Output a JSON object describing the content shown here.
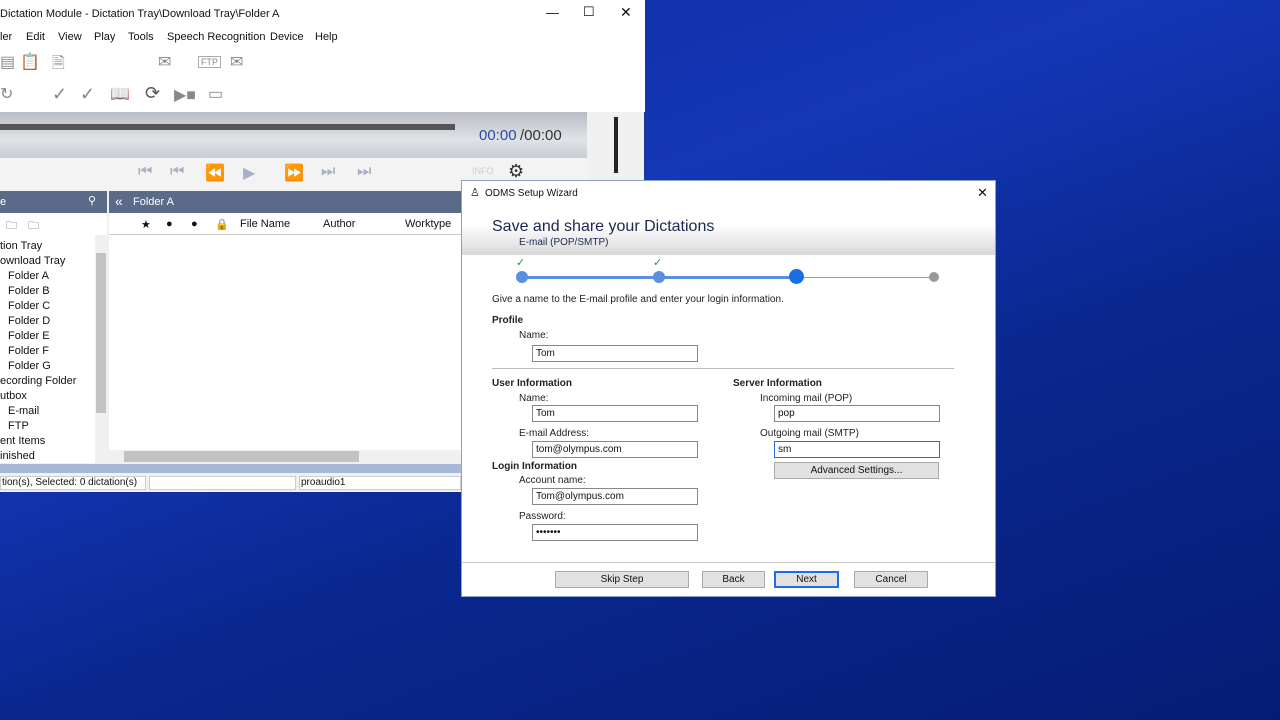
{
  "main": {
    "title": "Dictation Module - Dictation Tray\\Download Tray\\Folder A",
    "menu": [
      "ler",
      "Edit",
      "View",
      "Play",
      "Tools",
      "Speech Recognition",
      "Device",
      "Help"
    ],
    "time_current": "00:00",
    "time_total": "/00:00",
    "pane_left_title": "e",
    "pane_right_title": "Folder A",
    "columns": [
      "File Name",
      "Author",
      "Worktype"
    ],
    "tree": [
      "tion Tray",
      "ownload Tray",
      "Folder A",
      "Folder B",
      "Folder C",
      "Folder D",
      "Folder E",
      "Folder F",
      "Folder G",
      "ecording Folder",
      "utbox",
      "E-mail",
      "FTP",
      "ent Items",
      "inished"
    ],
    "status": [
      "tion(s), Selected: 0 dictation(s)",
      "",
      "proaudio1"
    ],
    "ftp_label": "FTP",
    "info_label": "INFO"
  },
  "wizard": {
    "title": "ODMS Setup Wizard",
    "heading": "Save and share your Dictations",
    "subheading": "E-mail (POP/SMTP)",
    "steps": {
      "total": 4,
      "current": 3,
      "completed": 2
    },
    "instruction": "Give a name to the E-mail profile and enter your login information.",
    "profile": {
      "section": "Profile",
      "name_label": "Name:",
      "name_value": "Tom"
    },
    "user": {
      "section": "User Information",
      "name_label": "Name:",
      "name_value": "Tom",
      "email_label": "E-mail Address:",
      "email_value": "tom@olympus.com"
    },
    "login": {
      "section": "Login Information",
      "account_label": "Account name:",
      "account_value": "Tom@olympus.com",
      "password_label": "Password:",
      "password_value": "•••••••"
    },
    "server": {
      "section": "Server Information",
      "pop_label": "Incoming mail (POP)",
      "pop_value": "pop",
      "smtp_label": "Outgoing mail (SMTP)",
      "smtp_value": "sm",
      "advanced": "Advanced Settings..."
    },
    "buttons": {
      "skip": "Skip Step",
      "back": "Back",
      "next": "Next",
      "cancel": "Cancel"
    },
    "colors": {
      "accent": "#1a6ee8",
      "done": "#5a8fe0",
      "check": "#2e8b3a"
    }
  }
}
